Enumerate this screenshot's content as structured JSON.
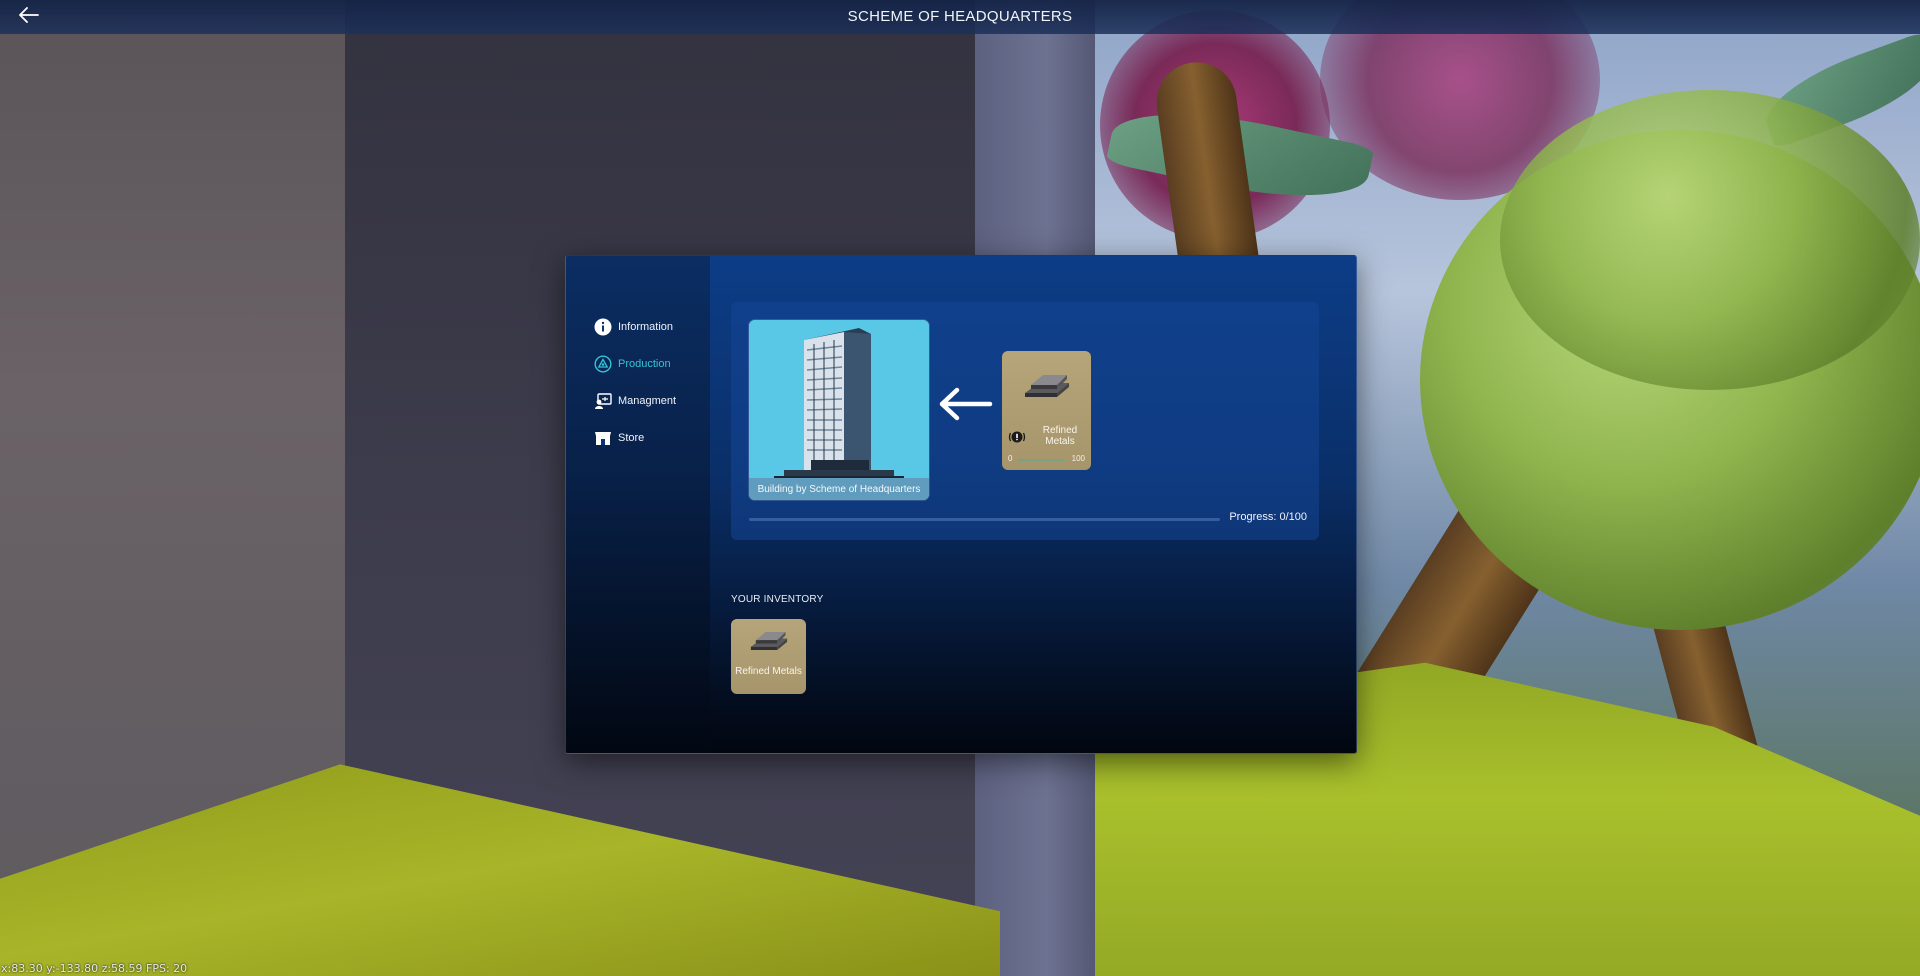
{
  "topbar": {
    "title": "SCHEME OF HEADQUARTERS",
    "back_icon": "arrow-left-icon"
  },
  "sidebar": {
    "items": [
      {
        "label": "Information",
        "icon": "info-circle-icon",
        "active": false
      },
      {
        "label": "Production",
        "icon": "production-icon",
        "active": true
      },
      {
        "label": "Managment",
        "icon": "management-icon",
        "active": false
      },
      {
        "label": "Store",
        "icon": "store-icon",
        "active": false
      }
    ],
    "active_color": "#35c3d6"
  },
  "production": {
    "building_caption": "Building by Scheme of Headquarters",
    "resource": {
      "name": "Refined Metals",
      "current": "0",
      "max": "100",
      "progress_fraction": 0.0
    },
    "progress_text": "Progress: 0/100",
    "progress_fraction": 0.0
  },
  "inventory": {
    "label": "YOUR INVENTORY",
    "items": [
      {
        "name": "Refined Metals"
      }
    ]
  },
  "debug": {
    "text": "x:83.30 y:-133.80 z:58.59 FPS: 20"
  },
  "colors": {
    "card_gold": "#b6a57a",
    "accent": "#35c3d6",
    "modal_top": "#0d3d87"
  }
}
